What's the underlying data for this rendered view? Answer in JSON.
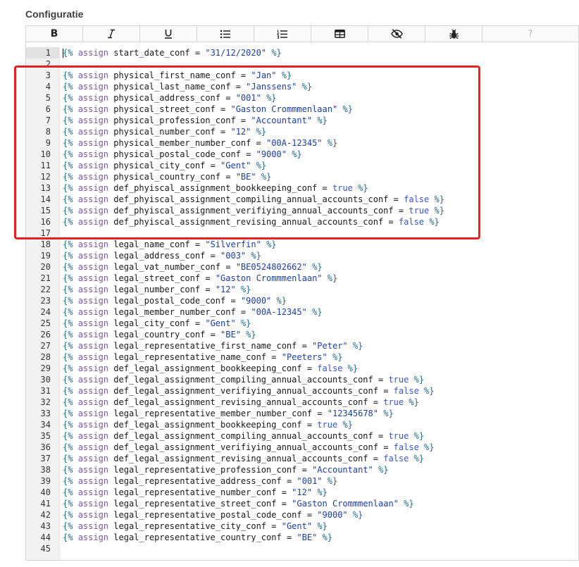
{
  "section_title": "Configuratie",
  "toolbar": [
    {
      "name": "bold-button",
      "icon": "bold-icon",
      "text": "B"
    },
    {
      "name": "italic-button",
      "icon": "italic-icon"
    },
    {
      "name": "underline-button",
      "icon": "underline-icon"
    },
    {
      "name": "bullet-list-button",
      "icon": "bullet-list-icon"
    },
    {
      "name": "numbered-list-button",
      "icon": "numbered-list-icon"
    },
    {
      "name": "table-button",
      "icon": "table-icon"
    },
    {
      "name": "preview-button",
      "icon": "eye-slash-icon"
    },
    {
      "name": "debug-button",
      "icon": "bug-icon"
    },
    {
      "name": "help-button",
      "icon": "question-icon",
      "text": "?"
    }
  ],
  "highlight_color": "#e32323",
  "code_lines": [
    {
      "n": "1",
      "t": "assign",
      "name": "start_date_conf",
      "v": "\"31/12/2020\"",
      "vt": "str"
    },
    {
      "n": "2",
      "t": "blank"
    },
    {
      "n": "3",
      "t": "assign",
      "name": "physical_first_name_conf",
      "v": "\"Jan\"",
      "vt": "str"
    },
    {
      "n": "4",
      "t": "assign",
      "name": "physical_last_name_conf",
      "v": "\"Janssens\"",
      "vt": "str"
    },
    {
      "n": "5",
      "t": "assign",
      "name": "physical_address_conf",
      "v": "\"001\"",
      "vt": "str"
    },
    {
      "n": "6",
      "t": "assign",
      "name": "physical_street_conf",
      "v": "\"Gaston Crommmenlaan\"",
      "vt": "str"
    },
    {
      "n": "7",
      "t": "assign",
      "name": "physical_profession_conf",
      "v": "\"Accountant\"",
      "vt": "str"
    },
    {
      "n": "8",
      "t": "assign",
      "name": "physical_number_conf",
      "v": "\"12\"",
      "vt": "str"
    },
    {
      "n": "9",
      "t": "assign",
      "name": "physical_member_number_conf",
      "v": "\"00A-12345\"",
      "vt": "str"
    },
    {
      "n": "10",
      "t": "assign",
      "name": "physical_postal_code_conf",
      "v": "\"9000\"",
      "vt": "str"
    },
    {
      "n": "11",
      "t": "assign",
      "name": "physical_city_conf",
      "v": "\"Gent\"",
      "vt": "str"
    },
    {
      "n": "12",
      "t": "assign",
      "name": "physical_country_conf",
      "v": "\"BE\"",
      "vt": "str"
    },
    {
      "n": "13",
      "t": "assign",
      "name": "def_phyiscal_assignment_bookkeeping_conf",
      "v": "true",
      "vt": "bool"
    },
    {
      "n": "14",
      "t": "assign",
      "name": "def_phyiscal_assignment_compiling_annual_accounts_conf",
      "v": "false",
      "vt": "bool"
    },
    {
      "n": "15",
      "t": "assign",
      "name": "def_phyiscal_assignment_verifiying_annual_accounts_conf",
      "v": "true",
      "vt": "bool"
    },
    {
      "n": "16",
      "t": "assign",
      "name": "def_phyiscal_assignment_revising_annual_accounts_conf",
      "v": "false",
      "vt": "bool"
    },
    {
      "n": "17",
      "t": "blank"
    },
    {
      "n": "18",
      "t": "assign",
      "name": "legal_name_conf",
      "v": "\"Silverfin\"",
      "vt": "str"
    },
    {
      "n": "19",
      "t": "assign",
      "name": "legal_address_conf",
      "v": "\"003\"",
      "vt": "str"
    },
    {
      "n": "20",
      "t": "assign",
      "name": "legal_vat_number_conf",
      "v": "\"BE0524802662\"",
      "vt": "str"
    },
    {
      "n": "21",
      "t": "assign",
      "name": "legal_street_conf",
      "v": "\"Gaston Crommmenlaan\"",
      "vt": "str"
    },
    {
      "n": "22",
      "t": "assign",
      "name": "legal_number_conf",
      "v": "\"12\"",
      "vt": "str"
    },
    {
      "n": "23",
      "t": "assign",
      "name": "legal_postal_code_conf",
      "v": "\"9000\"",
      "vt": "str"
    },
    {
      "n": "24",
      "t": "assign",
      "name": "legal_member_number_conf",
      "v": "\"00A-12345\"",
      "vt": "str"
    },
    {
      "n": "25",
      "t": "assign",
      "name": "legal_city_conf",
      "v": "\"Gent\"",
      "vt": "str"
    },
    {
      "n": "26",
      "t": "assign",
      "name": "legal_country_conf",
      "v": "\"BE\"",
      "vt": "str"
    },
    {
      "n": "27",
      "t": "assign",
      "name": "legal_representative_first_name_conf",
      "v": "\"Peter\"",
      "vt": "str"
    },
    {
      "n": "28",
      "t": "assign",
      "name": "legal_representative_name_conf",
      "v": "\"Peeters\"",
      "vt": "str"
    },
    {
      "n": "29",
      "t": "assign",
      "name": "def_legal_assignment_bookkeeping_conf",
      "v": "false",
      "vt": "bool"
    },
    {
      "n": "30",
      "t": "assign",
      "name": "def_legal_assignment_compiling_annual_accounts_conf",
      "v": "true",
      "vt": "bool"
    },
    {
      "n": "31",
      "t": "assign",
      "name": "def_legal_assignment_verifiying_annual_accounts_conf",
      "v": "false",
      "vt": "bool"
    },
    {
      "n": "32",
      "t": "assign",
      "name": "def_legal_assignment_revising_annual_accounts_conf",
      "v": "true",
      "vt": "bool"
    },
    {
      "n": "33",
      "t": "assign",
      "name": "legal_representative_member_number_conf",
      "v": "\"12345678\"",
      "vt": "str"
    },
    {
      "n": "34",
      "t": "assign",
      "name": "def_legal_assignment_bookkeeping_conf",
      "v": "true",
      "vt": "bool"
    },
    {
      "n": "35",
      "t": "assign",
      "name": "def_legal_assignment_compiling_annual_accounts_conf",
      "v": "true",
      "vt": "bool"
    },
    {
      "n": "36",
      "t": "assign",
      "name": "def_legal_assignment_verifiying_annual_accounts_conf",
      "v": "false",
      "vt": "bool"
    },
    {
      "n": "37",
      "t": "assign",
      "name": "def_legal_assignment_revising_annual_accounts_conf",
      "v": "false",
      "vt": "bool"
    },
    {
      "n": "38",
      "t": "assign",
      "name": "legal_representative_profession_conf",
      "v": "\"Accountant\"",
      "vt": "str"
    },
    {
      "n": "39",
      "t": "assign",
      "name": "legal_representative_address_conf",
      "v": "\"001\"",
      "vt": "str"
    },
    {
      "n": "40",
      "t": "assign",
      "name": "legal_representative_number_conf",
      "v": "\"12\"",
      "vt": "str"
    },
    {
      "n": "41",
      "t": "assign",
      "name": "legal_representative_street_conf",
      "v": "\"Gaston Crommmenlaan\"",
      "vt": "str"
    },
    {
      "n": "42",
      "t": "assign",
      "name": "legal_representative_postal_code_conf",
      "v": "\"9000\"",
      "vt": "str"
    },
    {
      "n": "43",
      "t": "assign",
      "name": "legal_representative_city_conf",
      "v": "\"Gent\"",
      "vt": "str"
    },
    {
      "n": "44",
      "t": "assign",
      "name": "legal_representative_country_conf",
      "v": "\"BE\"",
      "vt": "str"
    },
    {
      "n": "45",
      "t": "blank"
    }
  ],
  "syntax": {
    "open": "{%",
    "close": "%}",
    "keyword": "assign",
    "op": "="
  }
}
